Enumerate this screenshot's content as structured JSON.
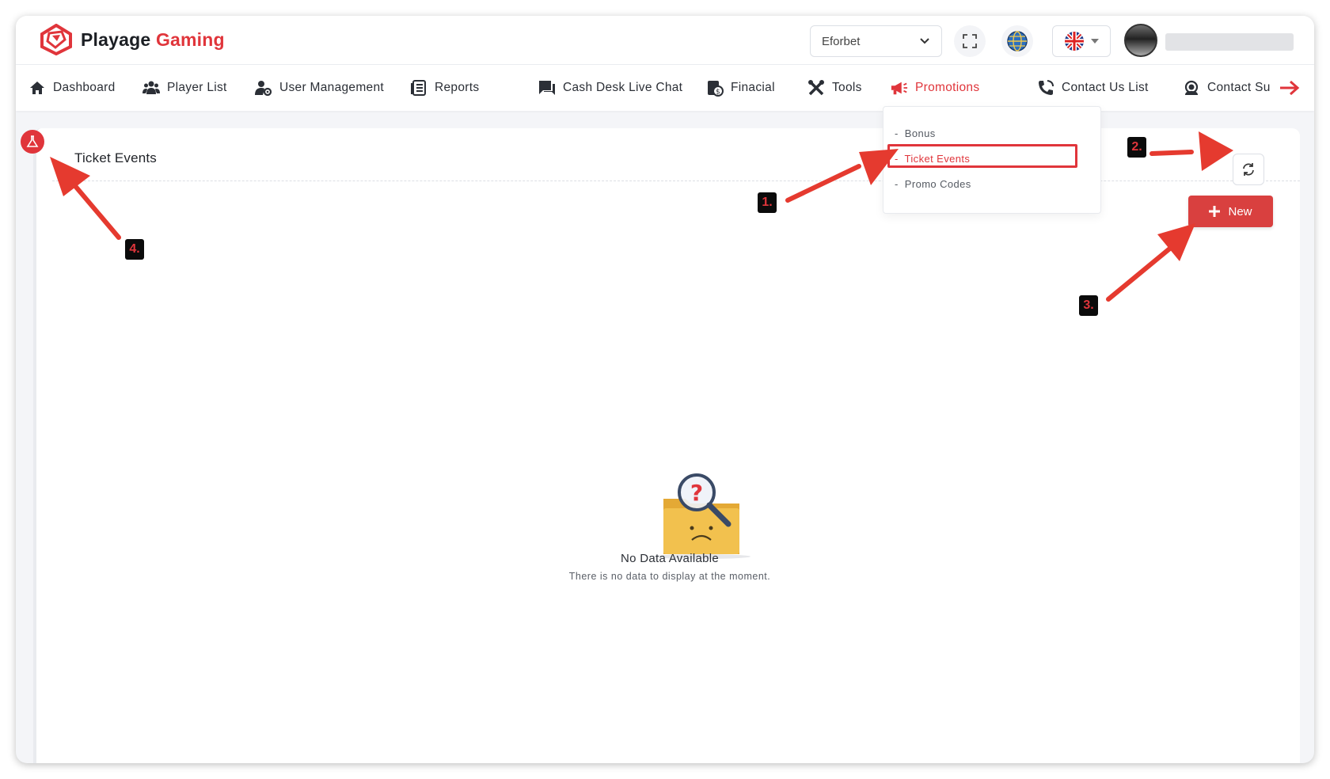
{
  "brand": {
    "name_part1": "Playage",
    "name_part2": "Gaming",
    "accent_color": "#e0353b"
  },
  "header": {
    "operator_select": {
      "value": "Eforbet",
      "icon": "chevron-down-icon"
    },
    "fullscreen_icon": "fullscreen-icon",
    "globe_icon": "globe-icon",
    "language_flag": "uk-flag-icon"
  },
  "nav": {
    "items": [
      {
        "label": "Dashboard",
        "icon": "home-icon"
      },
      {
        "label": "Player List",
        "icon": "users-icon"
      },
      {
        "label": "User Management",
        "icon": "user-gear-icon"
      },
      {
        "label": "Reports",
        "icon": "report-icon"
      },
      {
        "label": "Cash Desk Live Chat",
        "icon": "chat-icon"
      },
      {
        "label": "Finacial",
        "icon": "finance-icon"
      },
      {
        "label": "Tools",
        "icon": "tools-icon"
      },
      {
        "label": "Promotions",
        "icon": "megaphone-icon",
        "active": true
      },
      {
        "label": "Contact Us List",
        "icon": "phone-icon"
      },
      {
        "label": "Contact Su",
        "icon": "support-icon"
      }
    ],
    "more_icon": "arrow-right-icon"
  },
  "promotions_menu": {
    "items": [
      {
        "label": "Bonus"
      },
      {
        "label": "Ticket Events",
        "active": true
      },
      {
        "label": "Promo Codes"
      }
    ]
  },
  "page": {
    "title": "Ticket Events",
    "new_button": "New",
    "empty_title": "No Data Available",
    "empty_subtitle": "There is no data to display at the moment."
  },
  "annotations": {
    "labels": [
      "1.",
      "2.",
      "3.",
      "4."
    ]
  }
}
